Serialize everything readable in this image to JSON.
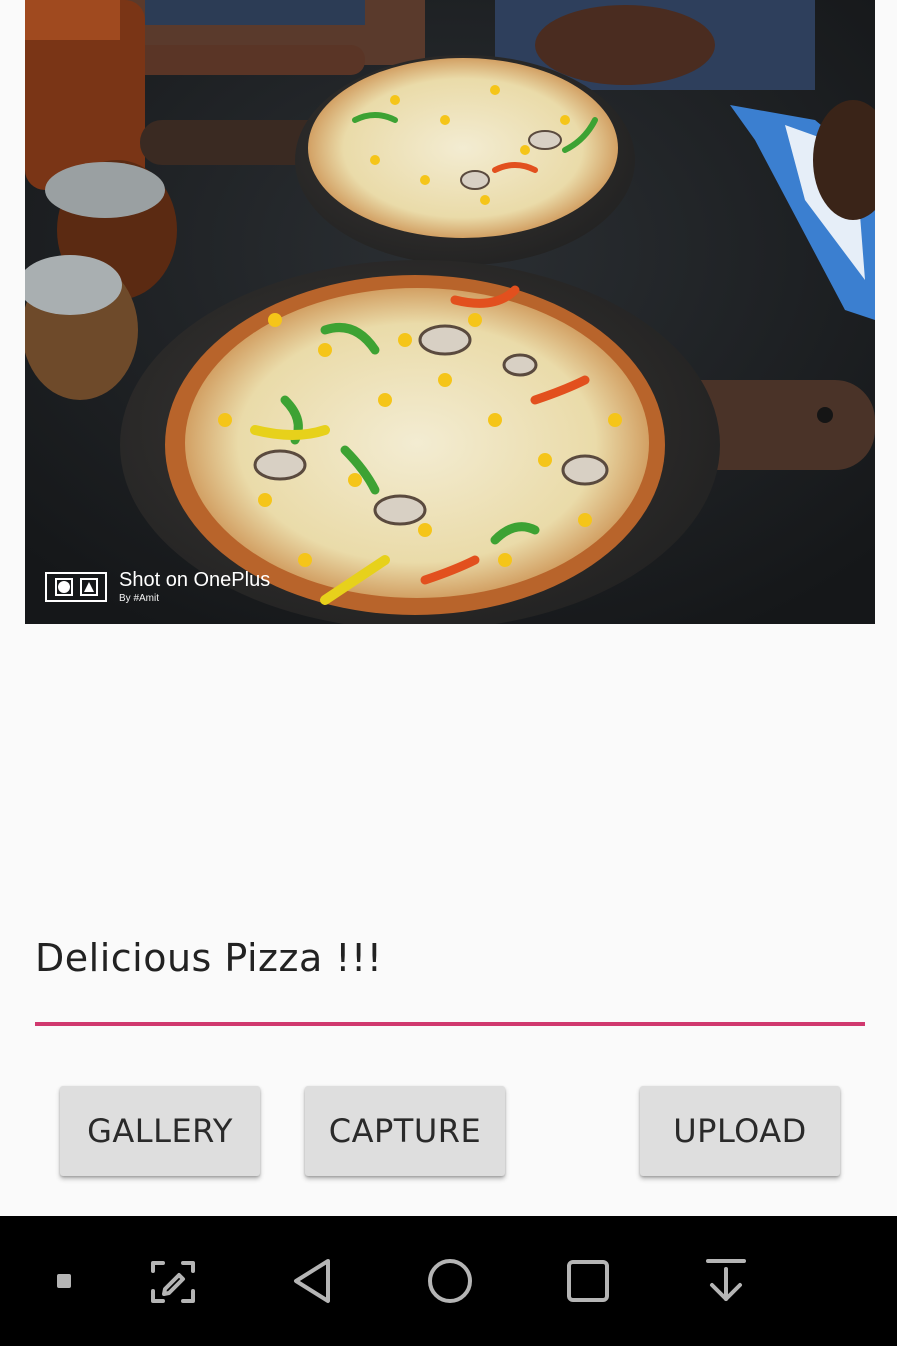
{
  "photo": {
    "watermark": {
      "main_text": "Shot on OnePlus",
      "sub_text": "By #Amit"
    }
  },
  "caption": {
    "value": "Delicious Pizza !!!",
    "underline_color": "#d0386e"
  },
  "buttons": {
    "gallery_label": "GALLERY",
    "capture_label": "CAPTURE",
    "upload_label": "UPLOAD"
  },
  "navbar": {
    "items": [
      {
        "icon": "square-dot-icon"
      },
      {
        "icon": "screenshot-edit-icon"
      },
      {
        "icon": "back-icon"
      },
      {
        "icon": "home-icon"
      },
      {
        "icon": "recents-icon"
      },
      {
        "icon": "notification-pull-icon"
      }
    ]
  }
}
